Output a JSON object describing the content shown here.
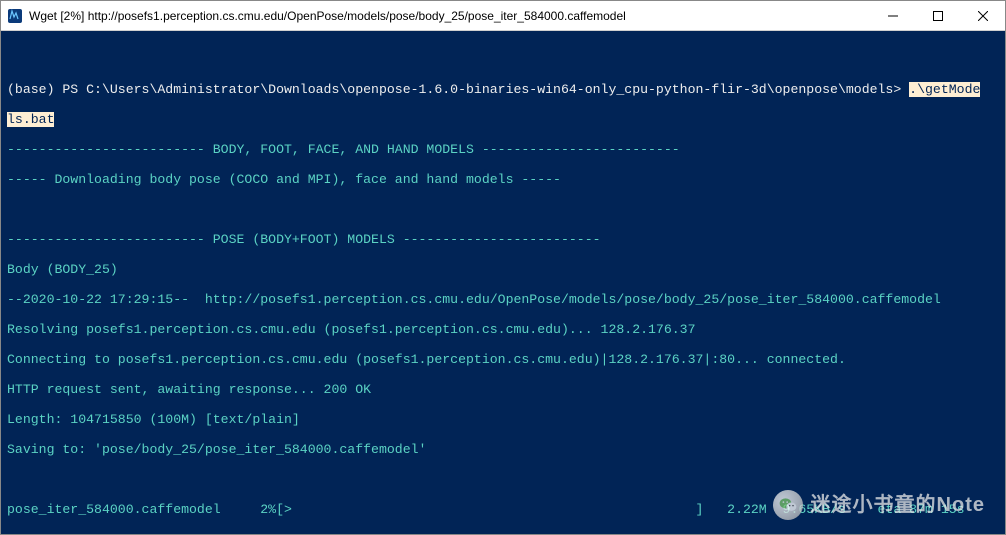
{
  "window": {
    "title": "Wget [2%] http://posefs1.perception.cs.cmu.edu/OpenPose/models/pose/body_25/pose_iter_584000.caffemodel"
  },
  "terminal": {
    "prompt_prefix": "(base) PS C:\\Users\\Administrator\\Downloads\\openpose-1.6.0-binaries-win64-only_cpu-python-flir-3d\\openpose\\models> ",
    "command_part1": ".\\getMode",
    "command_part2": "ls.bat",
    "line_header1": "------------------------- BODY, FOOT, FACE, AND HAND MODELS -------------------------",
    "line_header2": "----- Downloading body pose (COCO and MPI), face and hand models -----",
    "line_header3": "------------------------- POSE (BODY+FOOT) MODELS -------------------------",
    "line_body25": "Body (BODY_25)",
    "line_ts": "--2020-10-22 17:29:15--  http://posefs1.perception.cs.cmu.edu/OpenPose/models/pose/body_25/pose_iter_584000.caffemodel",
    "line_resolve": "Resolving posefs1.perception.cs.cmu.edu (posefs1.perception.cs.cmu.edu)... 128.2.176.37",
    "line_connect": "Connecting to posefs1.perception.cs.cmu.edu (posefs1.perception.cs.cmu.edu)|128.2.176.37|:80... connected.",
    "line_http": "HTTP request sent, awaiting response... 200 OK",
    "line_len": "Length: 104715850 (100M) [text/plain]",
    "line_save": "Saving to: 'pose/body_25/pose_iter_584000.caffemodel'",
    "progress": {
      "filename": "pose_iter_584000.caffemodel",
      "percent": "2%",
      "bar_open": "[",
      "bar_fill": ">",
      "bar_close": "]",
      "downloaded": "2.22M",
      "speed": "9.65KB/s",
      "eta": "eta 87m 15s"
    }
  },
  "watermark": {
    "text": "迷途小书童的Note",
    "icon_name": "wechat-icon"
  }
}
